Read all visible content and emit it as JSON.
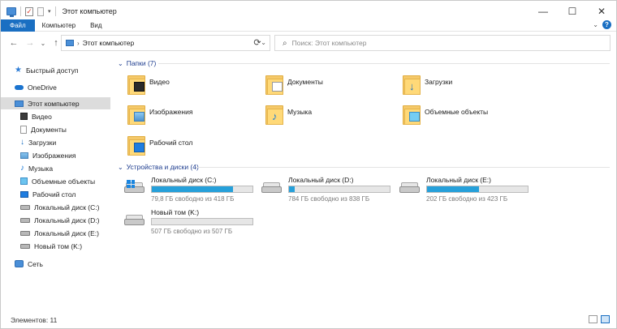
{
  "window": {
    "title": "Этот компьютер",
    "controls": {
      "minimize": "—",
      "maximize": "☐",
      "close": "✕"
    }
  },
  "ribbon": {
    "tabs": [
      "Файл",
      "Компьютер",
      "Вид"
    ],
    "help": "?"
  },
  "address": {
    "path": "Этот компьютер",
    "search_placeholder": "Поиск: Этот компьютер"
  },
  "sidebar": {
    "items": [
      {
        "label": "Быстрый доступ",
        "icon": "star-icon"
      },
      {
        "label": "OneDrive",
        "icon": "cloud-icon"
      },
      {
        "label": "Этот компьютер",
        "icon": "computer-icon",
        "selected": true
      },
      {
        "label": "Видео",
        "icon": "video-icon"
      },
      {
        "label": "Документы",
        "icon": "documents-icon"
      },
      {
        "label": "Загрузки",
        "icon": "download-icon"
      },
      {
        "label": "Изображения",
        "icon": "pictures-icon"
      },
      {
        "label": "Музыка",
        "icon": "music-icon"
      },
      {
        "label": "Объемные объекты",
        "icon": "3d-objects-icon"
      },
      {
        "label": "Рабочий стол",
        "icon": "desktop-icon"
      },
      {
        "label": "Локальный диск (C:)",
        "icon": "drive-icon"
      },
      {
        "label": "Локальный диск (D:)",
        "icon": "drive-icon"
      },
      {
        "label": "Локальный диск (E:)",
        "icon": "drive-icon"
      },
      {
        "label": "Новый том (K:)",
        "icon": "drive-icon"
      },
      {
        "label": "Сеть",
        "icon": "network-icon"
      }
    ]
  },
  "folders_section": {
    "title": "Папки (7)",
    "items": [
      {
        "label": "Видео",
        "icon": "video-folder-icon"
      },
      {
        "label": "Документы",
        "icon": "documents-folder-icon"
      },
      {
        "label": "Загрузки",
        "icon": "downloads-folder-icon"
      },
      {
        "label": "Изображения",
        "icon": "pictures-folder-icon"
      },
      {
        "label": "Музыка",
        "icon": "music-folder-icon"
      },
      {
        "label": "Объемные объекты",
        "icon": "3d-objects-folder-icon"
      },
      {
        "label": "Рабочий стол",
        "icon": "desktop-folder-icon"
      }
    ]
  },
  "drives_section": {
    "title": "Устройства и диски (4)",
    "items": [
      {
        "name": "Локальный диск (C:)",
        "free": "79,8 ГБ свободно из 418 ГБ",
        "used_fraction": 0.81,
        "system": true
      },
      {
        "name": "Локальный диск (D:)",
        "free": "784 ГБ свободно из 838 ГБ",
        "used_fraction": 0.06,
        "system": false
      },
      {
        "name": "Локальный диск (E:)",
        "free": "202 ГБ свободно из 423 ГБ",
        "used_fraction": 0.52,
        "system": false
      },
      {
        "name": "Новый том (K:)",
        "free": "507 ГБ свободно из 507 ГБ",
        "used_fraction": 0.0,
        "system": false
      }
    ]
  },
  "status": {
    "items_count": "Элементов: 11"
  },
  "colors": {
    "accent": "#1a6fc2",
    "drive_bar": "#26a0da",
    "section_heading": "#1e3d8f"
  }
}
